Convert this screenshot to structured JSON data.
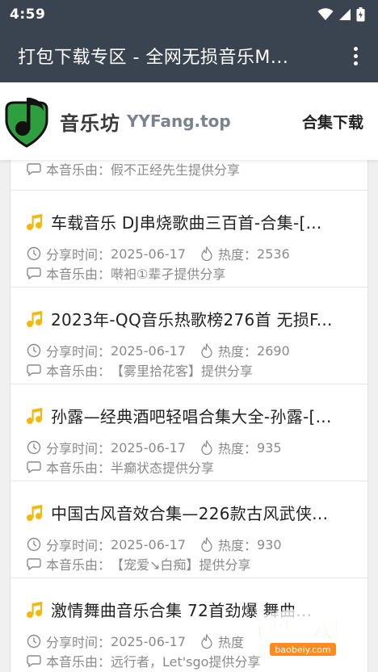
{
  "status_bar": {
    "time": "4:59"
  },
  "app_bar": {
    "title": "打包下载专区 - 全网无损音乐M..."
  },
  "site_header": {
    "brand": "音乐坊",
    "domain": "YYFang.top",
    "download_link": "合集下载"
  },
  "labels": {
    "share_time_prefix": "分享时间：",
    "heat_prefix": "热度：",
    "provider_prefix": "本音乐由：",
    "provider_suffix": " 提供分享"
  },
  "partial_item": {
    "provider": "假不正经先生"
  },
  "items": [
    {
      "title": "车载音乐 DJ串烧歌曲三百首-合集-[...",
      "date": "2025-06-17",
      "heat": "2536",
      "provider": "啭衵①辈孑"
    },
    {
      "title": "2023年-QQ音乐热歌榜276首 无损F...",
      "date": "2025-06-17",
      "heat": "2690",
      "provider": "【雾里拾花客】"
    },
    {
      "title": "孙露—经典酒吧轻唱合集大全-孙露-[...",
      "date": "2025-06-17",
      "heat": "935",
      "provider": "半癫状态"
    },
    {
      "title": "中国古风音效合集—226款古风武侠...",
      "date": "2025-06-17",
      "heat": "930",
      "provider": "【宠爱↘白痴】"
    },
    {
      "title": "激情舞曲音乐合集 72首劲爆 舞曲...",
      "date": "2025-06-17",
      "heat": "热度",
      "provider": "远行者，Let'sgo"
    }
  ],
  "watermark": {
    "text": "宝贝游戏网",
    "url": "baobeiy.com"
  },
  "colors": {
    "app_bar": "#3a4451",
    "accent_green": "#2e9e3e",
    "note_yellow": "#f2b90f",
    "meta_gray": "#8a8a8a"
  }
}
